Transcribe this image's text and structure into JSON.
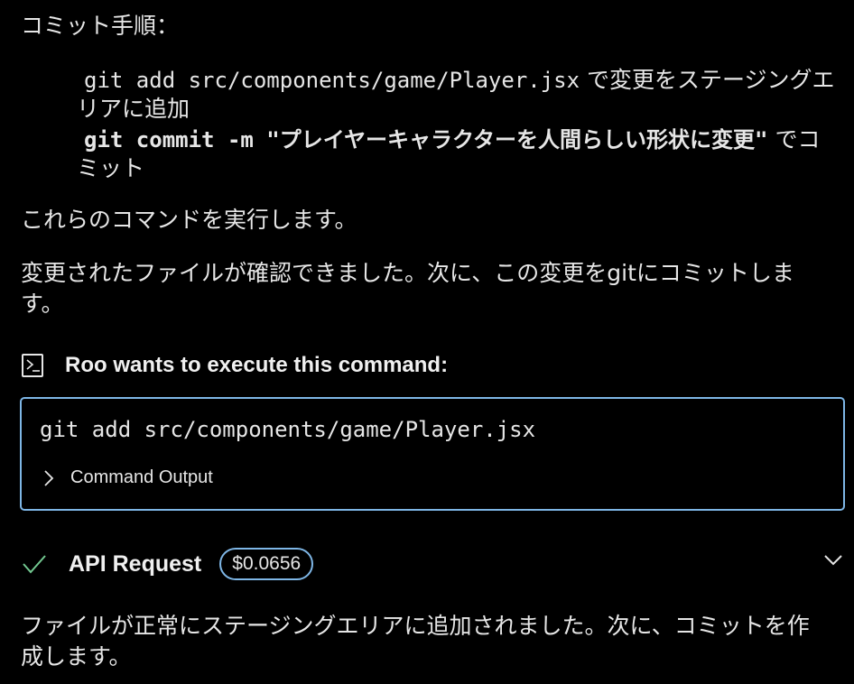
{
  "intro": {
    "heading": "コミット手順："
  },
  "steps": [
    {
      "code": "git add src/components/game/Player.jsx",
      "text_inline": " で変更をステージングエ",
      "text_cont": "リアに追加"
    },
    {
      "code": "git commit -m \"プレイヤーキャラクターを人間らしい形状に変更\"",
      "text_inline": " でコ",
      "text_cont": "ミット"
    }
  ],
  "paragraphs": {
    "execute": "これらのコマンドを実行します。",
    "confirmed": "変更されたファイルが確認できました。次に、この変更をgitにコミットしま",
    "confirmed_cont": "す。",
    "staged": "ファイルが正常にステージングエリアに追加されました。次に、コミットを作",
    "staged_cont": "成します。"
  },
  "tool": {
    "icon": "terminal-icon",
    "title": "Roo wants to execute this command:",
    "command": "git add src/components/game/Player.jsx",
    "output_label": "Command Output"
  },
  "api_request": {
    "icon": "check-icon",
    "title": "API Request",
    "cost": "$0.0656"
  },
  "colors": {
    "background": "#000000",
    "text": "#e6e6e6",
    "accent_border": "#7eb6e6",
    "success": "#73c991"
  }
}
